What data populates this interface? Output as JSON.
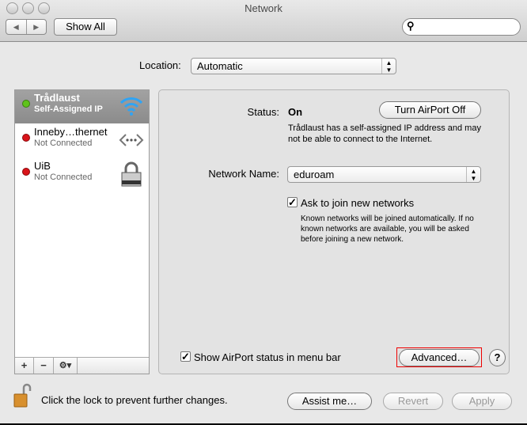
{
  "window": {
    "title": "Network"
  },
  "toolbar": {
    "show_all": "Show All",
    "search_placeholder": ""
  },
  "location": {
    "label": "Location:",
    "value": "Automatic"
  },
  "services": [
    {
      "name": "Trådlaust",
      "status": "Self-Assigned IP",
      "status_color": "#5fc31a",
      "icon": "wifi-icon"
    },
    {
      "name": "Inneby…thernet",
      "status": "Not Connected",
      "status_color": "#d9141a",
      "icon": "ethernet-icon"
    },
    {
      "name": "UiB",
      "status": "Not Connected",
      "status_color": "#d9141a",
      "icon": "vpn-lock-icon"
    }
  ],
  "list_bar": {
    "add": "+",
    "remove": "−",
    "action": "⚙▾"
  },
  "detail": {
    "status_label": "Status:",
    "status_value": "On",
    "turn_off": "Turn AirPort Off",
    "status_desc": "Trådlaust has a self-assigned IP address and may not be able to connect to the Internet.",
    "network_name_label": "Network Name:",
    "network_name": "eduroam",
    "ask_join_label": "Ask to join new networks",
    "ask_join_checked": true,
    "ask_join_desc": "Known networks will be joined automatically. If no known networks are available, you will be asked before joining a new network.",
    "show_status_label": "Show AirPort status in menu bar",
    "show_status_checked": true,
    "advanced": "Advanced…",
    "help": "?"
  },
  "footer": {
    "lock_text": "Click the lock to prevent further changes.",
    "assist": "Assist me…",
    "revert": "Revert",
    "apply": "Apply"
  }
}
